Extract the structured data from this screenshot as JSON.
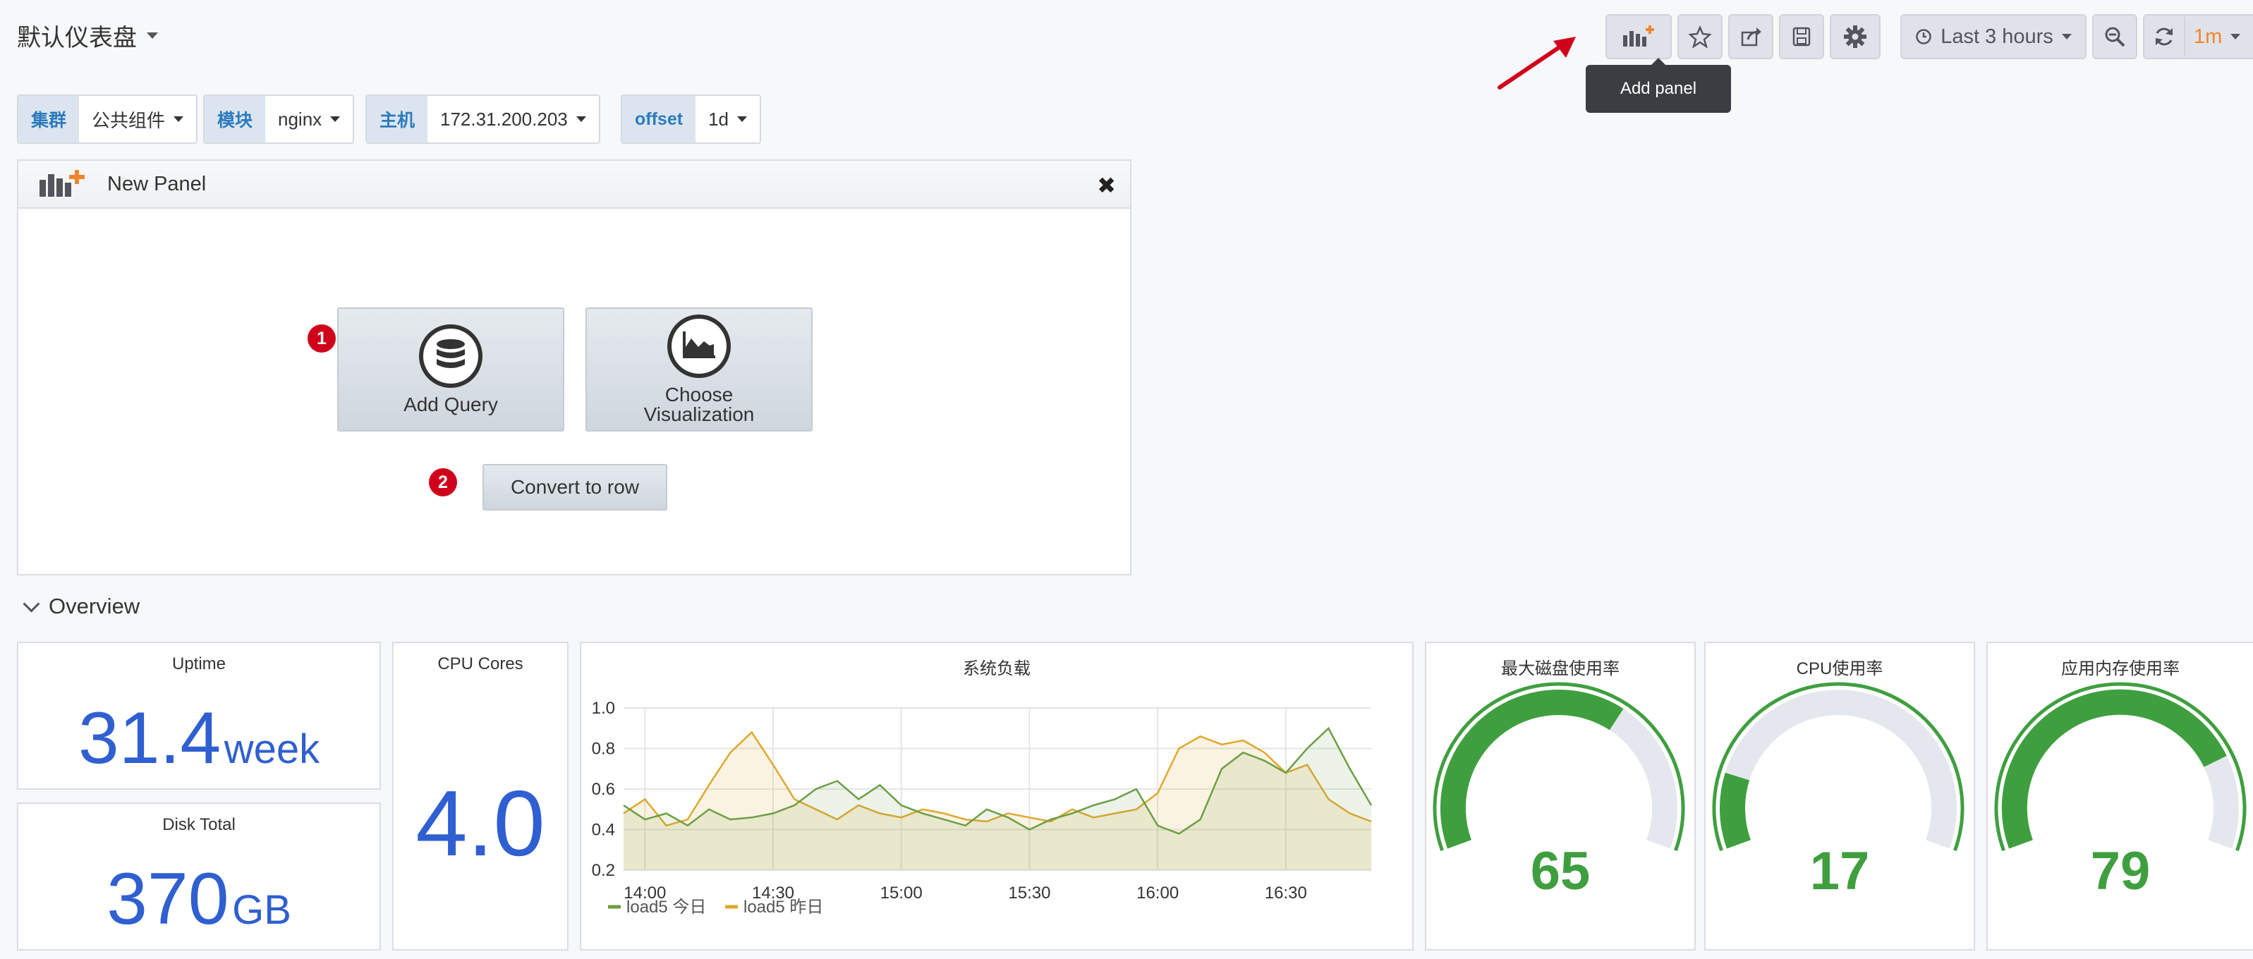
{
  "header": {
    "dashboard_title": "默认仪表盘",
    "time_range": "Last 3 hours",
    "refresh": "1m",
    "tooltip": "Add panel",
    "icons": [
      "add-panel-icon",
      "star-icon",
      "share-icon",
      "save-icon",
      "gear-icon",
      "clock-icon",
      "zoom-out-icon",
      "refresh-icon"
    ]
  },
  "variables": [
    {
      "label": "集群",
      "value": "公共组件"
    },
    {
      "label": "模块",
      "value": "nginx"
    },
    {
      "label": "主机",
      "value": "172.31.200.203"
    },
    {
      "label": "offset",
      "value": "1d"
    }
  ],
  "new_panel": {
    "title": "New Panel",
    "add_query": "Add Query",
    "choose_viz_line1": "Choose",
    "choose_viz_line2": "Visualization",
    "convert_to_row": "Convert to row",
    "badge1": "1",
    "badge2": "2"
  },
  "overview": {
    "row_title": "Overview",
    "uptime": {
      "title": "Uptime",
      "value": "31.4",
      "unit": "week"
    },
    "disk_total": {
      "title": "Disk Total",
      "value": "370",
      "unit": "GB"
    },
    "cpu_cores": {
      "title": "CPU Cores",
      "value": "4.0"
    },
    "load_chart": {
      "title": "系统负载"
    },
    "gauges": [
      {
        "title": "最大磁盘使用率",
        "value": "65"
      },
      {
        "title": "CPU使用率",
        "value": "17"
      },
      {
        "title": "应用内存使用率",
        "value": "79"
      }
    ]
  },
  "colors": {
    "stat_blue": "#2f5fd0",
    "gauge_green": "#3f9f3f",
    "gauge_track": "#e4e8ee",
    "series_today": "#6c9f44",
    "series_yesterday": "#e0a82e",
    "badge_red": "#d0021b",
    "arrow_red": "#d0021b"
  },
  "chart_data": {
    "type": "line",
    "title": "系统负载",
    "x": [
      "13:55",
      "14:00",
      "14:05",
      "14:10",
      "14:15",
      "14:20",
      "14:25",
      "14:30",
      "14:35",
      "14:40",
      "14:45",
      "14:50",
      "14:55",
      "15:00",
      "15:05",
      "15:10",
      "15:15",
      "15:20",
      "15:25",
      "15:30",
      "15:35",
      "15:40",
      "15:45",
      "15:50",
      "15:55",
      "16:00",
      "16:05",
      "16:10",
      "16:15",
      "16:20",
      "16:25",
      "16:30",
      "16:35",
      "16:40",
      "16:45",
      "16:50"
    ],
    "xticks": [
      "14:00",
      "14:30",
      "15:00",
      "15:30",
      "16:00",
      "16:30"
    ],
    "yticks": [
      "0.2",
      "0.4",
      "0.6",
      "0.8",
      "1.0"
    ],
    "ylim": [
      0.2,
      1.0
    ],
    "series": [
      {
        "name": "load5 今日",
        "color": "#6c9f44",
        "values": [
          0.52,
          0.45,
          0.48,
          0.42,
          0.5,
          0.45,
          0.46,
          0.48,
          0.52,
          0.6,
          0.64,
          0.55,
          0.62,
          0.52,
          0.48,
          0.45,
          0.42,
          0.5,
          0.46,
          0.4,
          0.45,
          0.48,
          0.52,
          0.55,
          0.6,
          0.42,
          0.38,
          0.45,
          0.7,
          0.78,
          0.74,
          0.68,
          0.8,
          0.9,
          0.7,
          0.52
        ]
      },
      {
        "name": "load5 昨日",
        "color": "#e0a82e",
        "values": [
          0.48,
          0.55,
          0.42,
          0.45,
          0.62,
          0.78,
          0.88,
          0.72,
          0.55,
          0.5,
          0.45,
          0.52,
          0.48,
          0.46,
          0.5,
          0.48,
          0.45,
          0.44,
          0.48,
          0.46,
          0.44,
          0.5,
          0.46,
          0.48,
          0.5,
          0.58,
          0.8,
          0.86,
          0.82,
          0.84,
          0.78,
          0.68,
          0.72,
          0.55,
          0.48,
          0.44
        ]
      }
    ]
  }
}
